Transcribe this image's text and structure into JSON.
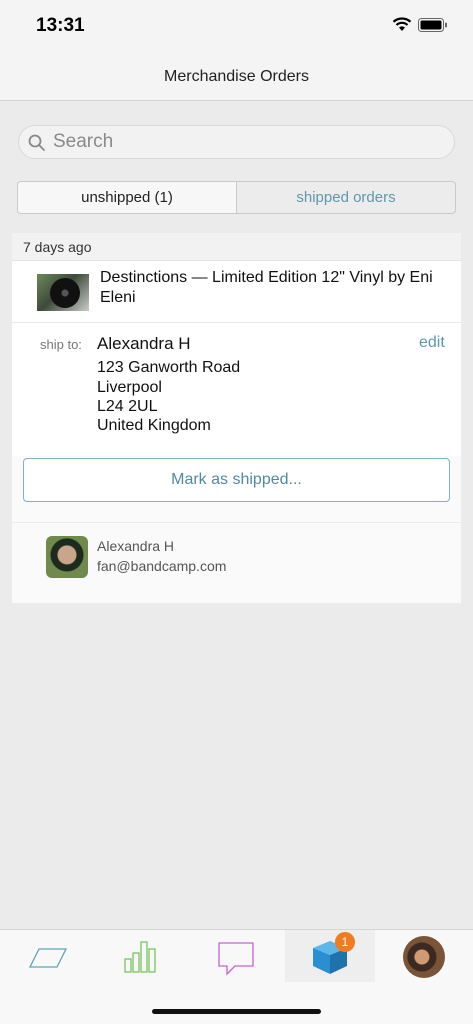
{
  "status": {
    "time": "13:31"
  },
  "nav": {
    "title": "Merchandise Orders"
  },
  "search": {
    "placeholder": "Search"
  },
  "tabs": {
    "unshipped": "unshipped (1)",
    "shipped": "shipped orders"
  },
  "order": {
    "date_header": "7 days ago",
    "item_title": "Destinctions — Limited Edition 12\" Vinyl by Eni Eleni",
    "ship_label": "ship to:",
    "ship_name": "Alexandra H",
    "edit_label": "edit",
    "address": [
      "123 Ganworth Road",
      "Liverpool",
      "L24 2UL",
      "United Kingdom"
    ],
    "mark_shipped_label": "Mark as shipped...",
    "buyer_name": "Alexandra H",
    "buyer_email": "fan@bandcamp.com"
  },
  "tab_bar": {
    "items": [
      "feed-icon",
      "stats-icon",
      "messages-icon",
      "orders-icon",
      "profile-avatar"
    ],
    "orders_badge": "1",
    "colors": {
      "feed": "#5fa3b8",
      "stats": "#6fbf55",
      "messages": "#c463d1",
      "orders": "#2a8fd0",
      "badge": "#f07c21"
    }
  }
}
